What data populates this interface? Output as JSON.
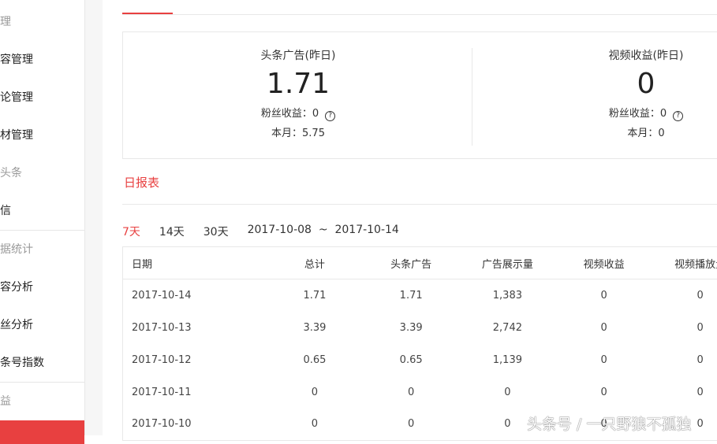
{
  "sidebar": {
    "items": [
      {
        "label": "管理",
        "type": "head"
      },
      {
        "label": "内容管理"
      },
      {
        "label": "评论管理"
      },
      {
        "label": "素材管理"
      },
      {
        "label": "微头条",
        "type": "head"
      },
      {
        "label": "私信"
      },
      {
        "label": "数据统计",
        "type": "head"
      },
      {
        "label": "内容分析"
      },
      {
        "label": "粉丝分析"
      },
      {
        "label": "头条号指数"
      },
      {
        "label": "收益",
        "type": "head"
      }
    ]
  },
  "stats": [
    {
      "title": "头条广告(昨日)",
      "value": "1.71",
      "fans_label": "粉丝收益：0",
      "month_label": "本月：5.75"
    },
    {
      "title": "视频收益(昨日)",
      "value": "0",
      "fans_label": "粉丝收益：0",
      "month_label": "本月：0"
    }
  ],
  "help_icon": "?",
  "report_tab": "日报表",
  "filters": {
    "options": [
      "7天",
      "14天",
      "30天"
    ],
    "range": "2017-10-08  ~  2017-10-14"
  },
  "table": {
    "headers": [
      "日期",
      "总计",
      "头条广告",
      "广告展示量",
      "视频收益",
      "视频播放量"
    ],
    "rows": [
      [
        "2017-10-14",
        "1.71",
        "1.71",
        "1,383",
        "0",
        "0"
      ],
      [
        "2017-10-13",
        "3.39",
        "3.39",
        "2,742",
        "0",
        "0"
      ],
      [
        "2017-10-12",
        "0.65",
        "0.65",
        "1,139",
        "0",
        "0"
      ],
      [
        "2017-10-11",
        "0",
        "0",
        "0",
        "0",
        "0"
      ],
      [
        "2017-10-10",
        "0",
        "0",
        "0",
        "0",
        "0"
      ]
    ]
  },
  "watermark": "头条号 / 一只野狼不孤独"
}
